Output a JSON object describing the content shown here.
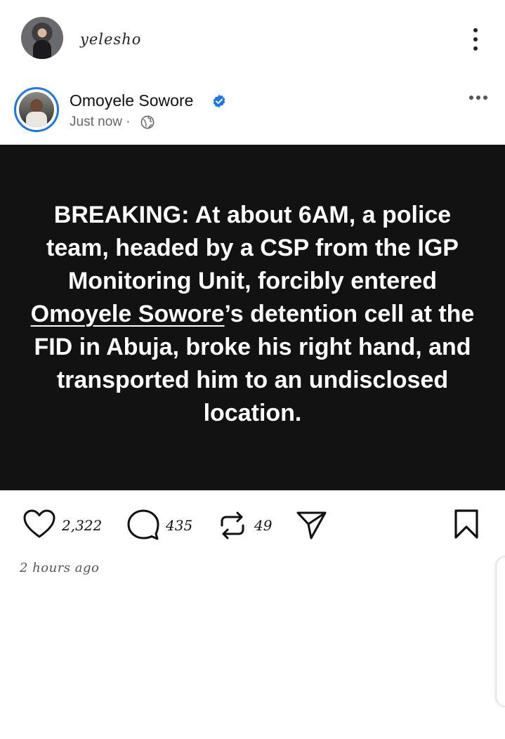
{
  "header": {
    "username": "yelesho"
  },
  "post": {
    "author": "Omoyele Sowore",
    "timestamp": "Just now",
    "meta_separator": "·",
    "text_before": "BREAKING: At about 6AM, a police team, headed by a CSP from the IGP Monitoring Unit, forcibly entered ",
    "mention": "Omoyele Sowore",
    "text_after": "’s detention cell at the FID in Abuja, broke his right hand, and transported him to an undisclosed location."
  },
  "actions": {
    "likes": "2,322",
    "comments": "435",
    "reposts": "49"
  },
  "footer": {
    "time_ago": "2 hours ago"
  },
  "colors": {
    "verified": "#1877f2",
    "card_bg": "#121212"
  },
  "icons": [
    "more-vertical-icon",
    "verified-badge-icon",
    "globe-icon",
    "more-horizontal-icon",
    "heart-icon",
    "comment-icon",
    "repost-icon",
    "send-icon",
    "bookmark-icon"
  ]
}
